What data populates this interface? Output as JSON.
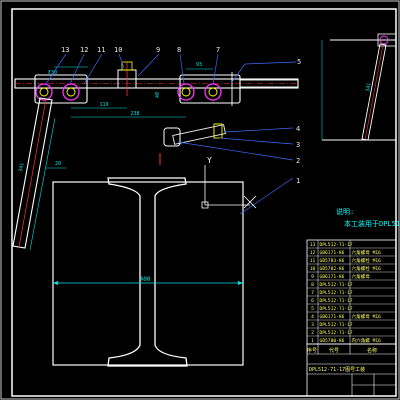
{
  "colors": {
    "background": "#000000",
    "frame": "#ffffff",
    "part_outline": "#ffffff",
    "leader": "#3b6bff",
    "callout_text": "#e8e8e8",
    "dimension": "#00e6e6",
    "pivot": "#ff33ff",
    "rod": "#ff3030",
    "hatch": "#ffff00",
    "note_text": "#00ffff",
    "table_text": "#ffff66",
    "table_lines": "#ffffff",
    "ucs": "#ffffff",
    "bolt_assembly": "#e0e0e0"
  },
  "callouts": {
    "c13": "13",
    "c12": "12",
    "c11": "11",
    "c10": "10",
    "c9": "9",
    "c8": "8",
    "c7": "7",
    "c6": "6",
    "c5": "5",
    "c4": "4",
    "c3": "3",
    "c2": "2",
    "c1": "1"
  },
  "dimensions": {
    "top_small": "ξ30",
    "center_span": "60",
    "right_span": "93",
    "vertical_small": "40",
    "left_offset": "119",
    "left_span": "238",
    "small_left": "20",
    "beam_width": "400",
    "arm_length": "341",
    "side_arm_length": "341"
  },
  "note": {
    "title": "说明:",
    "line1": "本工装用于DPL512.7"
  },
  "ucs_label": "Y",
  "parts_table": {
    "rows": [
      {
        "no": "13",
        "code": "DPL512-71-17",
        "name": ""
      },
      {
        "no": "12",
        "code": "GB6171-86",
        "name": "六角螺母 M16"
      },
      {
        "no": "11",
        "code": "GB5783-86",
        "name": "六角螺栓 M16"
      },
      {
        "no": "10",
        "code": "GB5782-86",
        "name": "六角螺栓 M16"
      },
      {
        "no": "9",
        "code": "GB6171-86",
        "name": "六角螺母"
      },
      {
        "no": "8",
        "code": "DPL512-71-17",
        "name": ""
      },
      {
        "no": "7",
        "code": "DPL512-71-17",
        "name": ""
      },
      {
        "no": "6",
        "code": "DPL512-71-17",
        "name": ""
      },
      {
        "no": "5",
        "code": "DPL512-71-17",
        "name": ""
      },
      {
        "no": "4",
        "code": "GB6171-86",
        "name": "六角螺母 M16"
      },
      {
        "no": "3",
        "code": "DPL512-71-17",
        "name": ""
      },
      {
        "no": "2",
        "code": "DPL512-71-17",
        "name": ""
      },
      {
        "no": "1",
        "code": "GB5700-86",
        "name": "内六角螺 M16"
      }
    ],
    "header": {
      "col1": "序号",
      "col2": "代号",
      "col3": "名称"
    },
    "title_block": "DPL512-71-17图号工装"
  }
}
